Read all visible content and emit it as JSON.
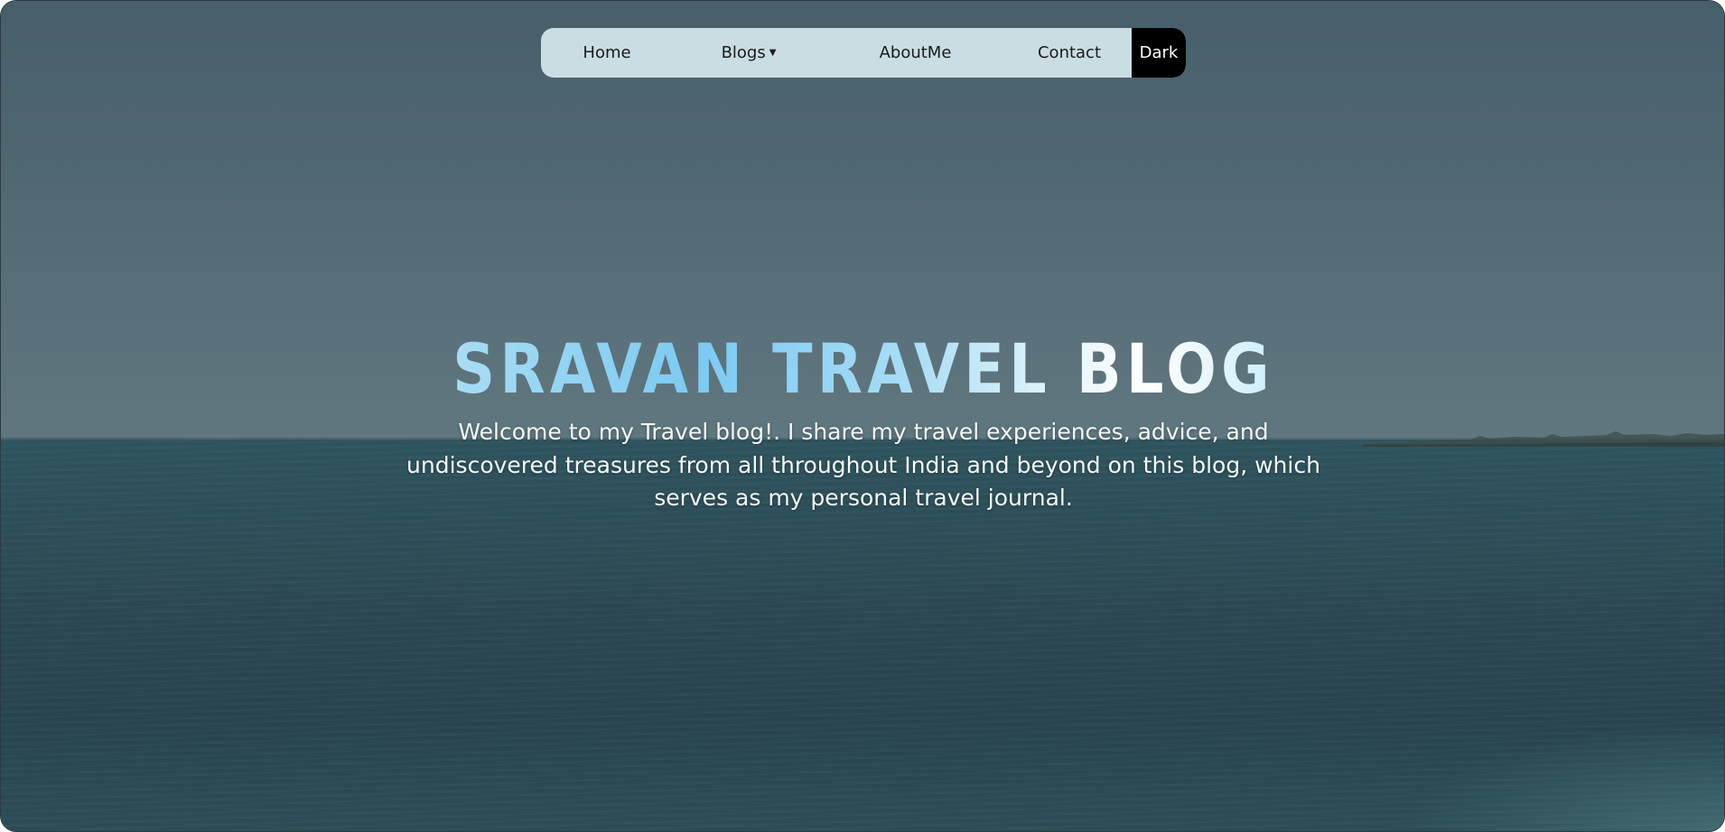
{
  "nav": {
    "home": "Home",
    "blogs": "Blogs",
    "about": "AboutMe",
    "contact": "Contact",
    "theme_toggle": "Dark"
  },
  "hero": {
    "title": "SRAVAN TRAVEL BLOG",
    "description": "Welcome to my Travel blog!. I share my travel experiences, advice, and undiscovered treasures from all throughout India and beyond on this blog, which serves as my personal travel journal."
  },
  "icons": {
    "blogs_dropdown": "caret-down-icon"
  },
  "colors": {
    "navbar_bg": "#c9dde3",
    "dark_button_bg": "#000000",
    "title_accent": "#7ccaf2"
  }
}
